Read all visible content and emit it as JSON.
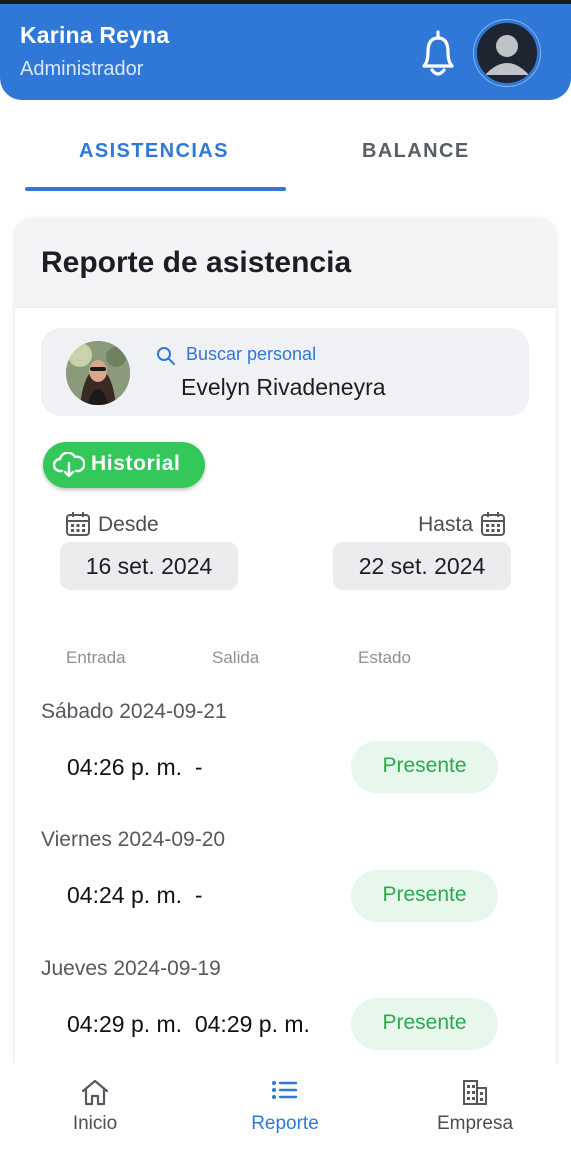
{
  "header": {
    "user_name": "Karina Reyna",
    "user_role": "Administrador"
  },
  "tabs": [
    {
      "label": "ASISTENCIAS",
      "active": true
    },
    {
      "label": "BALANCE",
      "active": false
    }
  ],
  "report": {
    "title": "Reporte de asistencia",
    "search_label": "Buscar personal",
    "selected_person": "Evelyn Rivadeneyra",
    "history_button": "Historial",
    "from_label": "Desde",
    "from_date": "16 set. 2024",
    "to_label": "Hasta",
    "to_date": "22 set. 2024",
    "columns": [
      "Entrada",
      "Salida",
      "Estado"
    ],
    "records": [
      {
        "day": "Sábado 2024-09-21",
        "times": "04:26 p. m.  -",
        "status": "Presente"
      },
      {
        "day": "Viernes 2024-09-20",
        "times": "04:24 p. m.  -",
        "status": "Presente"
      },
      {
        "day": "Jueves 2024-09-19",
        "times": "04:29 p. m.  04:29 p. m.",
        "status": "Presente"
      }
    ]
  },
  "bottom_nav": [
    {
      "label": "Inicio",
      "icon": "home-icon",
      "active": false
    },
    {
      "label": "Reporte",
      "icon": "list-icon",
      "active": true
    },
    {
      "label": "Empresa",
      "icon": "building-icon",
      "active": false
    }
  ],
  "colors": {
    "primary": "#2f78d8",
    "success": "#34c759",
    "status_bg": "#e8f7ec",
    "status_text": "#2ea84f"
  }
}
